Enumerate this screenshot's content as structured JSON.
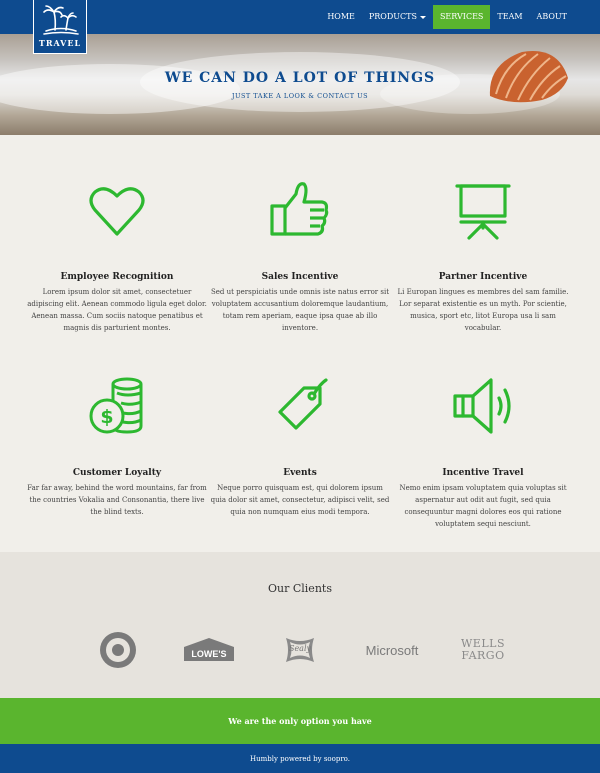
{
  "brand": {
    "logo_text": "TRAVEL"
  },
  "nav": {
    "items": [
      {
        "label": "HOME"
      },
      {
        "label": "PRODUCTS"
      },
      {
        "label": "SERVICES"
      },
      {
        "label": "TEAM"
      },
      {
        "label": "ABOUT"
      }
    ],
    "active": "SERVICES"
  },
  "hero": {
    "title": "WE CAN DO A LOT OF THINGS",
    "subtitle": "JUST TAKE A LOOK & CONTACT US"
  },
  "features": [
    {
      "icon": "heart-icon",
      "title": "Employee Recognition",
      "text": "Lorem ipsum dolor sit amet, consectetuer adipiscing elit. Aenean commodo ligula eget dolor. Aenean massa. Cum sociis natoque penatibus et magnis dis parturient montes."
    },
    {
      "icon": "thumbs-up-icon",
      "title": "Sales Incentive",
      "text": "Sed ut perspiciatis unde omnis iste natus error sit voluptatem accusantium doloremque laudantium, totam rem aperiam, eaque ipsa quae ab illo inventore."
    },
    {
      "icon": "presentation-board-icon",
      "title": "Partner Incentive",
      "text": "Li Europan lingues es membres del sam familie. Lor separat existentie es un myth. Por scientie, musica, sport etc, litot Europa usa li sam vocabular."
    },
    {
      "icon": "coins-dollar-icon",
      "title": "Customer Loyalty",
      "text": "Far far away, behind the word mountains, far from the countries Vokalia and Consonantia, there live the blind texts."
    },
    {
      "icon": "tag-icon",
      "title": "Events",
      "text": "Neque porro quisquam est, qui dolorem ipsum quia dolor sit amet, consectetur, adipisci velit, sed quia non numquam eius modi tempora."
    },
    {
      "icon": "speaker-icon",
      "title": "Incentive Travel",
      "text": "Nemo enim ipsam voluptatem quia voluptas sit aspernatur aut odit aut fugit, sed quia consequuntur magni dolores eos qui ratione voluptatem sequi nesciunt."
    }
  ],
  "clients": {
    "title": "Our Clients",
    "logos": [
      {
        "name": "target-logo"
      },
      {
        "name": "lowes-logo",
        "text": "LOWE'S"
      },
      {
        "name": "sealy-logo",
        "text": "Sealy"
      },
      {
        "name": "microsoft-logo",
        "text": "Microsoft"
      },
      {
        "name": "wells-fargo-logo",
        "text": "WELLS FARGO",
        "line1": "WELLS",
        "line2": "FARGO"
      }
    ]
  },
  "band": {
    "text": "We are the only option you have"
  },
  "footer": {
    "text": "Humbly powered by soopro."
  },
  "colors": {
    "brand_blue": "#0e4b8f",
    "accent_green": "#5ab52e",
    "icon_green": "#2db830",
    "logo_gray": "#777777"
  }
}
